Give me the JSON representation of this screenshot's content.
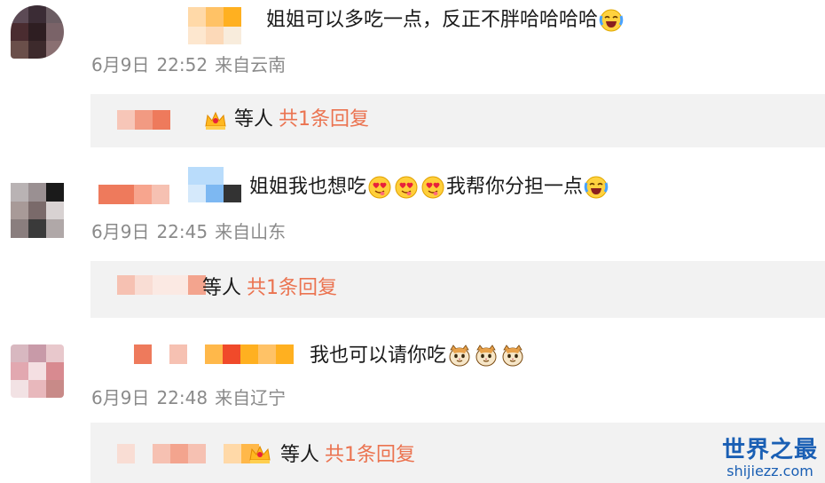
{
  "comments": [
    {
      "text": "姐姐可以多吃一点，反正不胖哈哈哈哈",
      "emojis": [
        "laugh-cry-emoji"
      ],
      "date": "6月9日",
      "time": "22:52",
      "location": "来自云南",
      "reply_people": "等人",
      "reply_count": "共1条回复"
    },
    {
      "text_before": "姐姐我也想吃",
      "emojis_mid": [
        "heart-eyes-drool-emoji",
        "heart-eyes-drool-emoji",
        "heart-eyes-drool-emoji"
      ],
      "text_after": "我帮你分担一点",
      "emojis_end": [
        "laugh-cry-emoji"
      ],
      "date": "6月9日",
      "time": "22:45",
      "location": "来自山东",
      "reply_people": "等人",
      "reply_count": "共1条回复"
    },
    {
      "text": "我也可以请你吃",
      "emojis": [
        "cat-face-emoji",
        "cat-face-emoji",
        "cat-face-emoji"
      ],
      "date": "6月9日",
      "time": "22:48",
      "location": "来自辽宁",
      "reply_people": "等人",
      "reply_count": "共1条回复"
    }
  ],
  "watermark": {
    "title": "世界之最",
    "url": "shijiezz.com"
  },
  "colors": {
    "reply_accent": "#eb7350",
    "meta_gray": "#8a8a8a",
    "reply_bg": "#f2f2f2"
  }
}
